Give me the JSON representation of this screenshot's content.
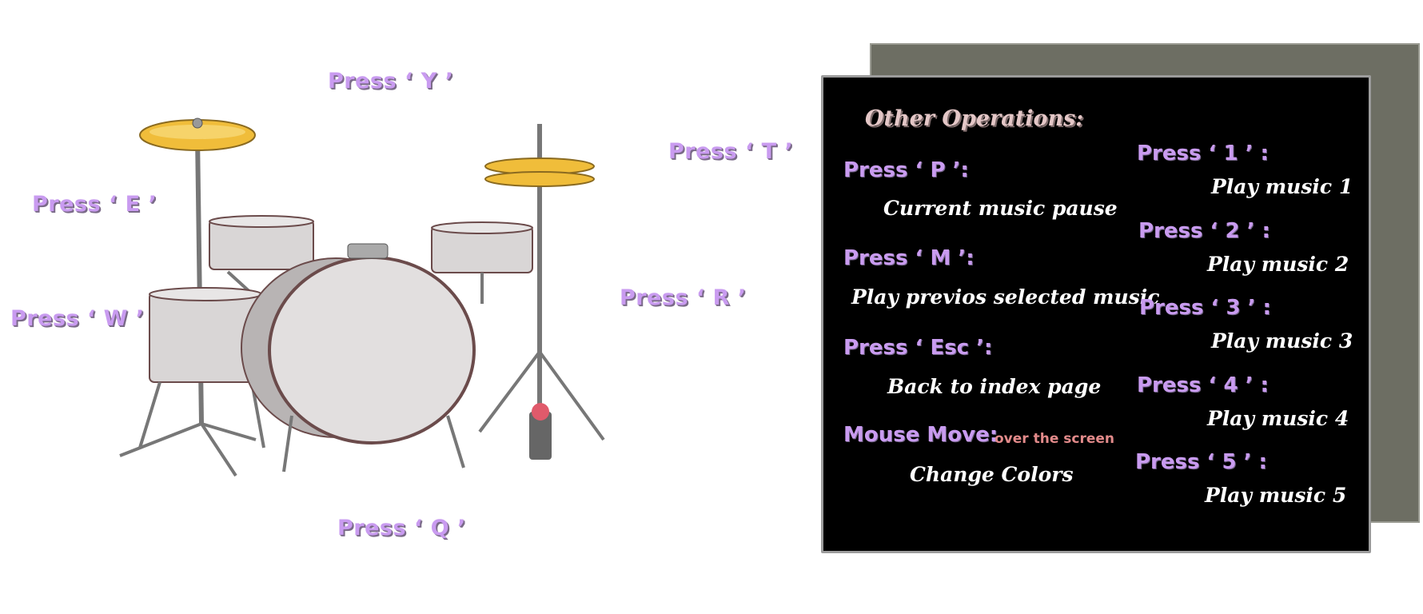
{
  "drum_keys": {
    "y": "Press ‘ Y ’",
    "t": "Press ‘ T ’",
    "e": "Press ‘ E ’",
    "w": "Press ‘ W ’",
    "r": "Press ‘ R ’",
    "q": "Press ‘ Q ’"
  },
  "panel": {
    "title": "Other Operations:",
    "left_ops": [
      {
        "key": "Press ‘ P ’:",
        "desc": "Current music pause"
      },
      {
        "key": "Press ‘ M ’:",
        "desc": "Play previos selected music"
      },
      {
        "key": "Press ‘ Esc ’:",
        "desc": "Back to index page"
      },
      {
        "key": "Mouse Move:",
        "note": "over the screen",
        "desc": "Change Colors"
      }
    ],
    "right_ops": [
      {
        "key": "Press ‘ 1 ’ :",
        "desc": "Play music 1"
      },
      {
        "key": "Press ‘ 2 ’ :",
        "desc": "Play music 2"
      },
      {
        "key": "Press ‘ 3 ’ :",
        "desc": "Play music 3"
      },
      {
        "key": "Press ‘ 4 ’ :",
        "desc": "Play music 4"
      },
      {
        "key": "Press ‘ 5 ’ :",
        "desc": "Play music 5"
      }
    ]
  },
  "colors": {
    "label_purple": "#c99bf0",
    "panel_bg": "#000000",
    "panel_shadow": "#6d6e63",
    "note_red": "#e28a8a",
    "cymbal_gold": "#f0bd3a"
  }
}
